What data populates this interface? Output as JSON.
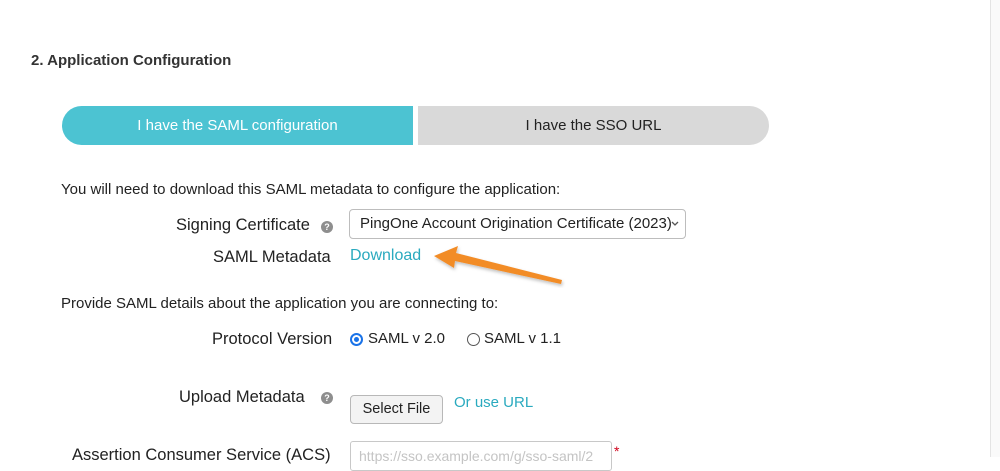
{
  "section": {
    "title": "2. Application Configuration"
  },
  "toggle": {
    "active_label": "I have the SAML configuration",
    "inactive_label": "I have the SSO URL"
  },
  "download_intro": "You will need to download this SAML metadata to configure the application:",
  "signing_certificate": {
    "label": "Signing Certificate",
    "selected": "PingOne Account Origination Certificate (2023)"
  },
  "saml_metadata": {
    "label": "SAML Metadata",
    "link": "Download"
  },
  "details_intro": "Provide SAML details about the application you are connecting to:",
  "protocol_version": {
    "label": "Protocol Version",
    "options": [
      {
        "label": "SAML v 2.0",
        "selected": true
      },
      {
        "label": "SAML v 1.1",
        "selected": false
      }
    ]
  },
  "upload_metadata": {
    "label": "Upload Metadata",
    "button": "Select File",
    "alt_link": "Or use URL"
  },
  "acs": {
    "label": "Assertion Consumer Service (ACS)",
    "placeholder": "https://sso.example.com/g/sso-saml/2"
  },
  "colors": {
    "accent": "#4cc3d2",
    "link": "#2aaabf",
    "arrow": "#f28c28",
    "inactive_tab": "#d9d9d9"
  },
  "icons": {
    "help": "question-circle-icon",
    "select": "chevron-updown-icon",
    "annotation": "arrow-icon"
  }
}
